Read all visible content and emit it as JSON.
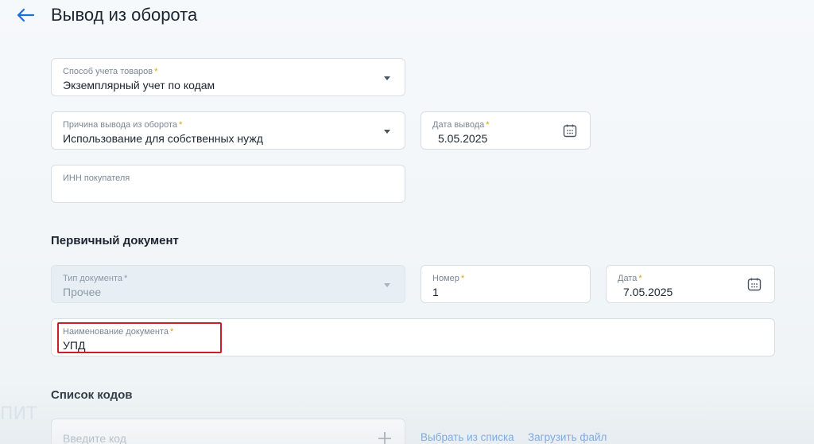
{
  "header": {
    "title": "Вывод из оборота",
    "back_icon": "arrow-left-icon"
  },
  "form": {
    "accounting_method": {
      "label": "Способ учета товаров",
      "required": "*",
      "value": "Экземплярный учет по кодам"
    },
    "withdrawal_reason": {
      "label": "Причина вывода из оборота",
      "required": "*",
      "value": "Использование для собственных нужд"
    },
    "withdrawal_date": {
      "label": "Дата вывода",
      "required": "*",
      "value": "5.05.2025"
    },
    "buyer_inn": {
      "label": "ИНН покупателя",
      "value": ""
    }
  },
  "primary_document": {
    "section_title": "Первичный документ",
    "doc_type": {
      "label": "Тип документа",
      "required": "*",
      "value": "Прочее"
    },
    "number": {
      "label": "Номер",
      "required": "*",
      "value": "1"
    },
    "date": {
      "label": "Дата",
      "required": "*",
      "value": "7.05.2025"
    },
    "doc_name": {
      "label": "Наименование документа",
      "required": "*",
      "value": "УПД"
    }
  },
  "codes": {
    "section_title": "Список кодов",
    "input_placeholder": "Введите код",
    "select_from_list": "Выбрать из списка",
    "upload_file": "Загрузить файл"
  },
  "watermark": "ПИТ",
  "colors": {
    "accent": "#1f6fd6",
    "required": "#e0a100",
    "highlight": "#c8202a"
  }
}
